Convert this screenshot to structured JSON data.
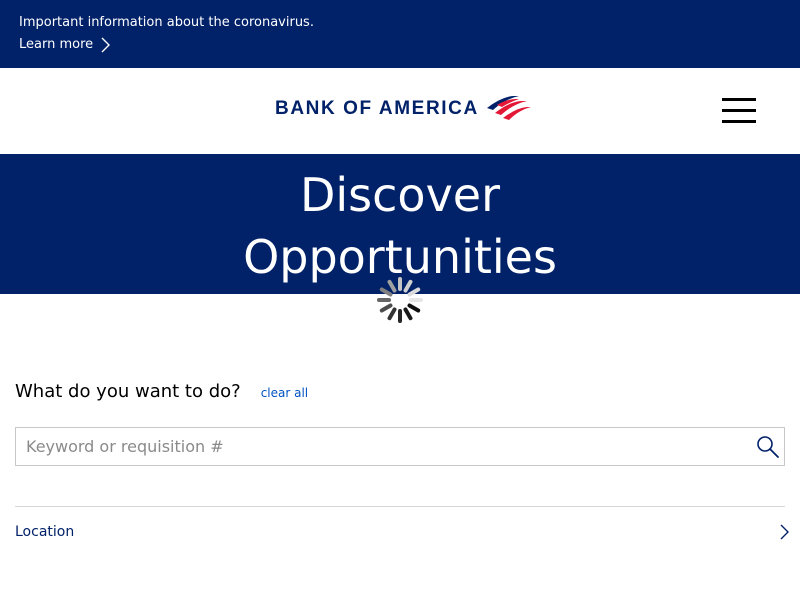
{
  "alert": {
    "text": "Important information about the coronavirus.",
    "link_label": "Learn more"
  },
  "header": {
    "logo_text": "BANK OF AMERICA",
    "menu_icon": "hamburger-menu-icon"
  },
  "hero": {
    "title_line1": "Discover",
    "title_line2": "Opportunities"
  },
  "search": {
    "question": "What do you want to do?",
    "clear_all_label": "clear all",
    "placeholder": "Keyword or requisition #",
    "value": ""
  },
  "filters": {
    "location_label": "Location"
  },
  "colors": {
    "brand_navy": "#012169",
    "brand_red": "#e31837",
    "link_blue": "#0052c2"
  }
}
